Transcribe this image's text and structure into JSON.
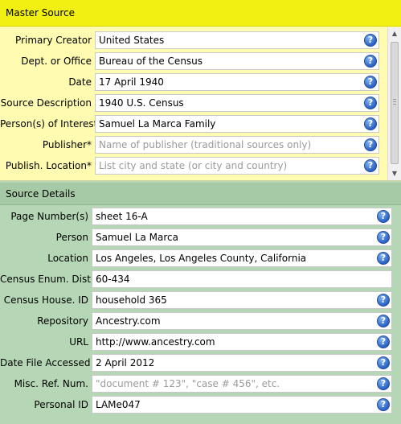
{
  "master": {
    "title": "Master Source",
    "fields": [
      {
        "label": "Primary Creator",
        "value": "United States",
        "placeholder": ""
      },
      {
        "label": "Dept. or Office",
        "value": "Bureau of the Census",
        "placeholder": ""
      },
      {
        "label": "Date",
        "value": "17 April 1940",
        "placeholder": ""
      },
      {
        "label": "Source Description",
        "value": "1940 U.S. Census",
        "placeholder": ""
      },
      {
        "label": "Person(s) of Interest",
        "value": "Samuel La Marca Family",
        "placeholder": ""
      },
      {
        "label": "Publisher*",
        "value": "",
        "placeholder": "Name of publisher (traditional sources only)"
      },
      {
        "label": "Publish. Location*",
        "value": "",
        "placeholder": "List city and state (or city and country)"
      }
    ]
  },
  "details": {
    "title": "Source Details",
    "fields": [
      {
        "label": "Page Number(s)",
        "value": "sheet 16-A",
        "placeholder": "",
        "help": true
      },
      {
        "label": "Person",
        "value": "Samuel La Marca",
        "placeholder": "",
        "help": true
      },
      {
        "label": "Location",
        "value": "Los Angeles, Los Angeles County, California",
        "placeholder": "",
        "help": true
      },
      {
        "label": "Census Enum. Dist.",
        "value": "60-434",
        "placeholder": "",
        "help": false
      },
      {
        "label": "Census House. ID",
        "value": "household 365",
        "placeholder": "",
        "help": true
      },
      {
        "label": "Repository",
        "value": "Ancestry.com",
        "placeholder": "",
        "help": true
      },
      {
        "label": "URL",
        "value": "http://www.ancestry.com",
        "placeholder": "",
        "help": true
      },
      {
        "label": "Date File Accessed",
        "value": "2 April 2012",
        "placeholder": "",
        "help": true
      },
      {
        "label": "Misc. Ref. Num.",
        "value": "",
        "placeholder": "\"document # 123\", \"case # 456\", etc.",
        "help": true
      },
      {
        "label": "Personal ID",
        "value": "LAMe047",
        "placeholder": "",
        "help": true
      }
    ]
  },
  "help_icon": "question-mark-icon",
  "help_glyph": "?",
  "colors": {
    "master_header": "#f2ef12",
    "master_background": "#fffbb0",
    "details_header": "#a6caa6",
    "details_background": "#b5d7b5",
    "help_icon": "#2c62c8",
    "placeholder_text": "#9a9a9a"
  }
}
